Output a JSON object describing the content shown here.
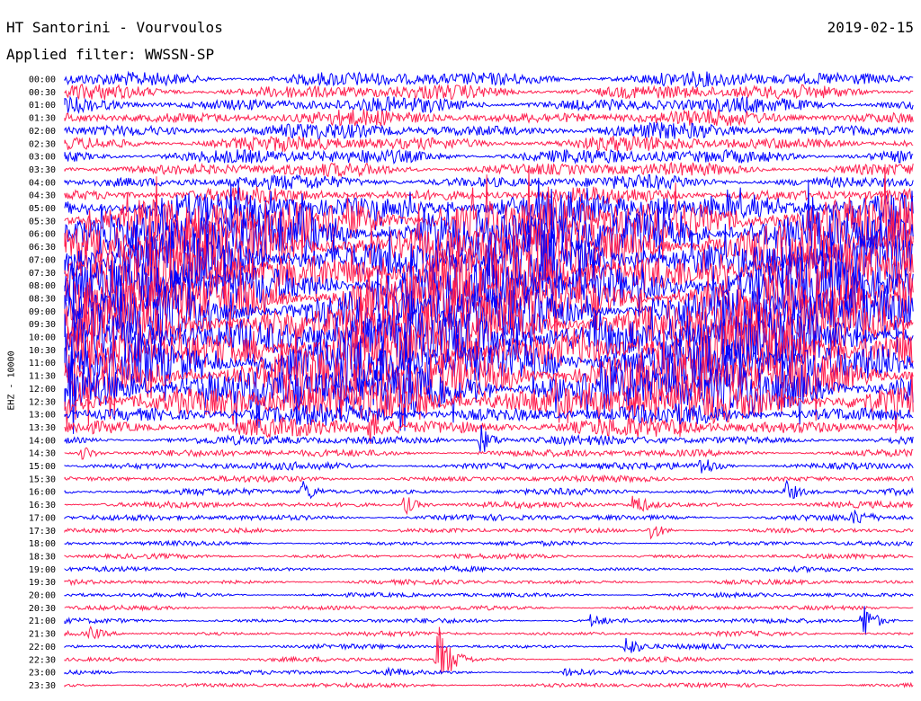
{
  "header": {
    "station": "HT Santorini - Vourvoulos",
    "date": "2019-02-15",
    "filter": "Applied filter: WWSSN-SP"
  },
  "side_label": "EHZ - 10000",
  "chart_data": {
    "type": "seismogram",
    "title": "HT Santorini - Vourvoulos",
    "ylabel": "EHZ - 10000",
    "row_labels": [
      "00:00",
      "00:30",
      "01:00",
      "01:30",
      "02:00",
      "02:30",
      "03:00",
      "03:30",
      "04:00",
      "04:30",
      "05:00",
      "05:30",
      "06:00",
      "06:30",
      "07:00",
      "07:30",
      "08:00",
      "08:30",
      "09:00",
      "09:30",
      "10:00",
      "10:30",
      "11:00",
      "11:30",
      "12:00",
      "12:30",
      "13:00",
      "13:30",
      "14:00",
      "14:30",
      "15:00",
      "15:30",
      "16:00",
      "16:30",
      "17:00",
      "17:30",
      "18:00",
      "18:30",
      "19:00",
      "19:30",
      "20:00",
      "20:30",
      "21:00",
      "21:30",
      "22:00",
      "22:30",
      "23:00",
      "23:30"
    ],
    "trace_colors": [
      "#0000ff",
      "#ff1f4f"
    ],
    "noise_level": [
      10,
      10,
      10,
      10,
      10,
      10,
      10,
      9,
      9,
      10,
      20,
      34,
      34,
      34,
      34,
      34,
      34,
      34,
      34,
      34,
      34,
      34,
      34,
      34,
      34,
      26,
      13,
      12,
      6,
      5,
      5,
      4,
      4,
      4,
      4,
      3,
      3,
      3,
      3,
      3,
      3,
      3,
      3,
      3,
      3,
      3,
      3,
      3
    ],
    "events": [
      {
        "row": 27,
        "x": 0.36,
        "amp": 16
      },
      {
        "row": 28,
        "x": 0.49,
        "amp": 18
      },
      {
        "row": 29,
        "x": 0.02,
        "amp": 10
      },
      {
        "row": 30,
        "x": 0.75,
        "amp": 12
      },
      {
        "row": 32,
        "x": 0.28,
        "amp": 14
      },
      {
        "row": 32,
        "x": 0.85,
        "amp": 12
      },
      {
        "row": 33,
        "x": 0.4,
        "amp": 12
      },
      {
        "row": 33,
        "x": 0.67,
        "amp": 14
      },
      {
        "row": 34,
        "x": 0.93,
        "amp": 8
      },
      {
        "row": 35,
        "x": 0.69,
        "amp": 12
      },
      {
        "row": 42,
        "x": 0.62,
        "amp": 8
      },
      {
        "row": 42,
        "x": 0.94,
        "amp": 24
      },
      {
        "row": 43,
        "x": 0.03,
        "amp": 7
      },
      {
        "row": 44,
        "x": 0.66,
        "amp": 14
      },
      {
        "row": 45,
        "x": 0.44,
        "amp": 40
      },
      {
        "row": 46,
        "x": 0.38,
        "amp": 6
      },
      {
        "row": 46,
        "x": 0.59,
        "amp": 7
      }
    ]
  }
}
